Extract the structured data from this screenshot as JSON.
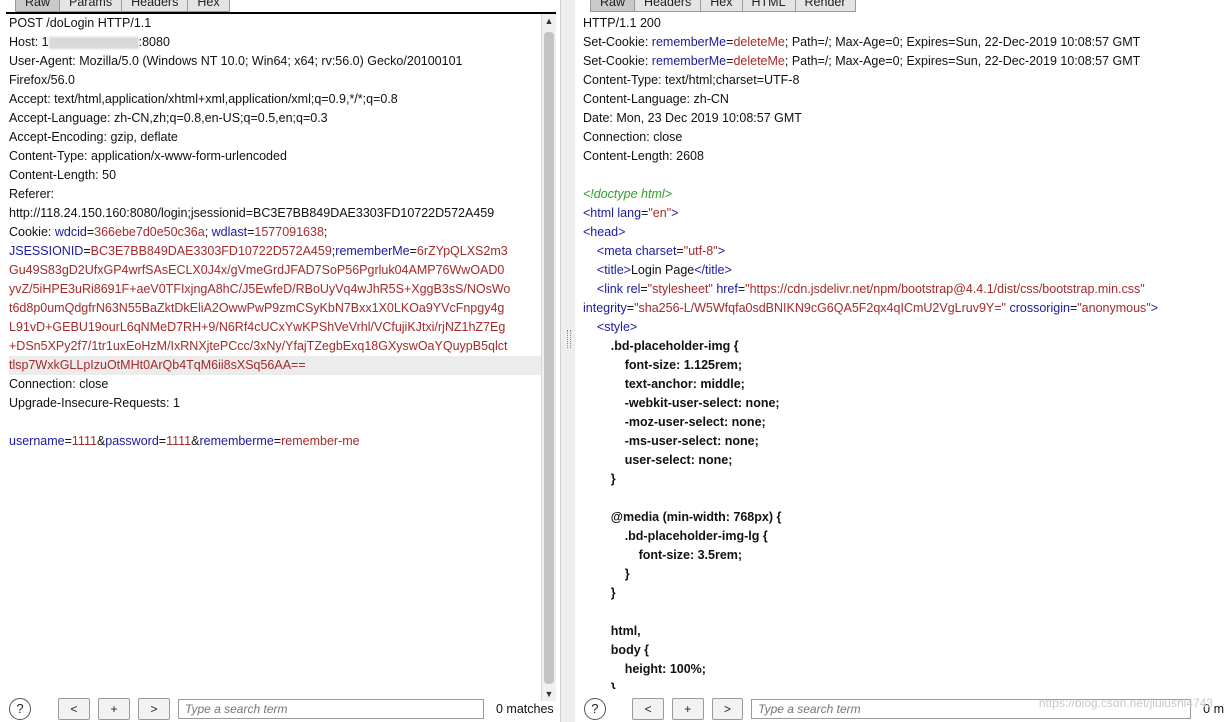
{
  "request": {
    "tabs": [
      "Raw",
      "Params",
      "Headers",
      "Hex"
    ],
    "headers": [
      {
        "name": "POST",
        "value": "/doLogin HTTP/1.1"
      },
      {
        "name": "Host:",
        "value_prefix": "1",
        "value_suffix": ":8080"
      },
      {
        "name": "User-Agent:",
        "value": "Mozilla/5.0 (Windows NT 10.0; Win64; x64; rv:56.0) Gecko/20100101"
      },
      {
        "name": "",
        "value": "Firefox/56.0"
      },
      {
        "name": "Accept:",
        "value": "text/html,application/xhtml+xml,application/xml;q=0.9,*/*;q=0.8"
      },
      {
        "name": "Accept-Language:",
        "value": "zh-CN,zh;q=0.8,en-US;q=0.5,en;q=0.3"
      },
      {
        "name": "Accept-Encoding:",
        "value": "gzip, deflate"
      },
      {
        "name": "Content-Type:",
        "value": "application/x-www-form-urlencoded"
      },
      {
        "name": "Content-Length:",
        "value": "50"
      },
      {
        "name": "Referer:",
        "value": ""
      },
      {
        "name": "",
        "value": "http://118.24.150.160:8080/login;jsessionid=BC3E7BB849DAE3303FD10722D572A459"
      }
    ],
    "cookie_label": "Cookie:",
    "cookies_line1": [
      {
        "k": "wdcid",
        "v": "366ebe7d0e50c36a"
      },
      {
        "k": "wdlast",
        "v": "1577091638"
      }
    ],
    "cookie_jsession_key": "JSESSIONID",
    "cookie_jsession_val": "BC3E7BB849DAE3303FD10722D572A459",
    "cookie_remember_key": "rememberMe",
    "remember_lines": [
      "6rZYpQLXS2m3",
      "Gu49S83gD2UfxGP4wrfSAsECLX0J4x/gVmeGrdJFAD7SoP56Pgrluk04AMP76WwOAD0",
      "yvZ/5iHPE3uRi8691F+aeV0TFIxjngA8hC/J5EwfeD/RBoUyVq4wJhR5S+XggB3sS/NOsWo",
      "t6d8p0umQdgfrN63N55BaZktDkEliA2OwwPwP9zmCSyKbN7Bxx1X0LKOa9YVcFnpgy4g",
      "L91vD+GEBU19ourL6qNMeD7RH+9/N6Rf4cUCxYwKPShVeVrhl/VCfujiKJtxi/rjNZ1hZ7Eg",
      "+DSn5XPy2f7/1tr1uxEoHzM/IxRNXjtePCcc/3xNy/YfajTZegbExq18GXyswOaYQuypB5qlct",
      "tlsp7WxkGLLpIzuOtMHt0ArQb4TqM6ii8sXSq56AA=="
    ],
    "tail_headers": [
      {
        "name": "Connection:",
        "value": "close"
      },
      {
        "name": "Upgrade-Insecure-Requests:",
        "value": "1"
      }
    ],
    "body_params": [
      {
        "k": "username",
        "v": "1111"
      },
      {
        "k": "password",
        "v": "1111"
      },
      {
        "k": "rememberme",
        "v": "remember-me"
      }
    ]
  },
  "response": {
    "tabs": [
      "Raw",
      "Headers",
      "Hex",
      "HTML",
      "Render"
    ],
    "status_line": "HTTP/1.1 200",
    "set_cookie_label": "Set-Cookie:",
    "set_cookie_key": "rememberMe",
    "set_cookie_val": "deleteMe",
    "set_cookie_rest": "; Path=/; Max-Age=0; Expires=Sun, 22-Dec-2019 10:08:57 GMT",
    "headers": [
      {
        "name": "Content-Type:",
        "value": "text/html;charset=UTF-8"
      },
      {
        "name": "Content-Language:",
        "value": "zh-CN"
      },
      {
        "name": "Date:",
        "value": "Mon, 23 Dec 2019 10:08:57 GMT"
      },
      {
        "name": "Connection:",
        "value": "close"
      },
      {
        "name": "Content-Length:",
        "value": "2608"
      }
    ],
    "doctype": "<!doctype html>",
    "html_open": "<html",
    "html_lang_attr": "lang",
    "html_lang_val": "\"en\"",
    "head_open": "<head>",
    "meta_tag": "<meta",
    "meta_attr": "charset",
    "meta_val": "\"utf-8\"",
    "title_open": "<title>",
    "title_text": "Login Page",
    "title_close": "</title>",
    "link_tag": "<link",
    "link_rel_attr": "rel",
    "link_rel_val": "\"stylesheet\"",
    "link_href_attr": "href",
    "link_href_val": "\"https://cdn.jsdelivr.net/npm/bootstrap@4.4.1/dist/css/bootstrap.min.css\"",
    "integrity_attr": "integrity",
    "integrity_val": "\"sha256-L/W5Wfqfa0sdBNIKN9cG6QA5F2qx4qICmU2VgLruv9Y=\"",
    "crossorigin_attr": "crossorigin",
    "crossorigin_val": "\"anonymous\"",
    "style_open": "<style>",
    "css_lines": [
      ".bd-placeholder-img {",
      "font-size: 1.125rem;",
      "text-anchor: middle;",
      "-webkit-user-select: none;",
      "-moz-user-select: none;",
      "-ms-user-select: none;",
      "user-select: none;",
      "}",
      "",
      "@media (min-width: 768px) {",
      ".bd-placeholder-img-lg {",
      "font-size: 3.5rem;",
      "}",
      "}",
      "",
      "html,",
      "body {",
      "height: 100%;",
      "}"
    ]
  },
  "footer": {
    "help": "?",
    "prev": "<",
    "add": "+",
    "next": ">",
    "search_placeholder": "Type a search term",
    "left_matches": "0 matches",
    "right_matches": "0 m"
  },
  "watermark": "https://blog.csdn.net/jiulushi4743"
}
